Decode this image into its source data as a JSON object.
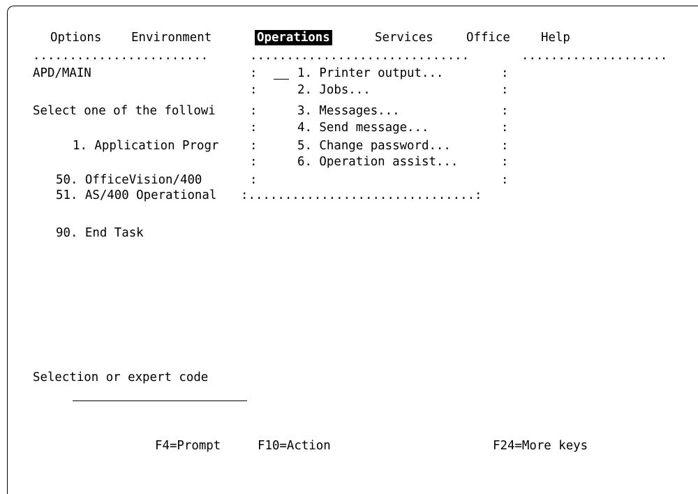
{
  "menubar": {
    "options": "Options",
    "environment": "Environment",
    "operations": "Operations",
    "services": "Services",
    "office": "Office",
    "help": "Help"
  },
  "dots": {
    "seg1": "........................",
    "seg2": "..............................",
    "seg3": "...................."
  },
  "main": {
    "menu_id": "APD/MAIN",
    "prompt": "Select one of the followi",
    "options": [
      {
        "label": "1. Application Progr"
      },
      {
        "label": "50. OfficeVision/400"
      },
      {
        "label": "51. AS/400 Operational"
      },
      {
        "label": "90. End Task"
      }
    ],
    "selection_label": "Selection or expert code"
  },
  "popup": {
    "colon": ":",
    "bottom": ":...............................:",
    "items": [
      {
        "label": "1. Printer output..."
      },
      {
        "label": "2. Jobs..."
      },
      {
        "label": "3. Messages..."
      },
      {
        "label": "4. Send message..."
      },
      {
        "label": "5. Change password..."
      },
      {
        "label": "6. Operation assist..."
      }
    ]
  },
  "fkeys": {
    "f4": "F4=Prompt",
    "f10": "F10=Action",
    "f24": "F24=More keys"
  }
}
